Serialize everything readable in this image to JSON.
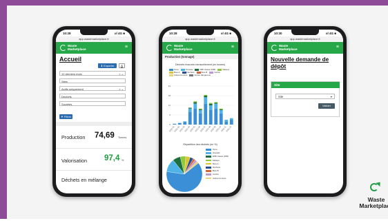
{
  "colors": {
    "frame": "#8e4c98",
    "brand_green": "#27a848",
    "primary_blue": "#2b6cb0",
    "kpi_green": "#1f9d3f",
    "button_dark": "#455a64"
  },
  "app": {
    "name_line1": "Waste",
    "name_line2": "Marketplace",
    "menu_icon": "hamburger-icon"
  },
  "status": {
    "time": "10:28",
    "time3": "10:30",
    "signal": "ııl 4G ■",
    "url": "app.wastemarketplace.fr"
  },
  "phone1": {
    "title": "Accueil",
    "export_label": "Exporter",
    "print_icon": "printer-icon",
    "filters": [
      {
        "value": "12 derniers mois",
        "dropdown": "× ⌄"
      },
      {
        "value": "Sites",
        "dropdown": ""
      },
      {
        "value": "Actifs uniquement",
        "dropdown": "× ⌄"
      },
      {
        "value": "Déchets",
        "dropdown": ""
      },
      {
        "value": "Sociétés",
        "dropdown": ""
      }
    ],
    "filter_button": "Filtrer",
    "kpis": [
      {
        "label": "Production",
        "value": "74,69",
        "unit": "Tonnes"
      },
      {
        "label": "Valorisation",
        "value": "97,4",
        "unit": "%"
      },
      {
        "label": "Déchets en mélange",
        "value": "",
        "unit": ""
      }
    ]
  },
  "phone2": {
    "section": "Production (tonnage)",
    "bar_title": "Déchets évacués mensuellement (en tonnes)",
    "pie_title": "Répartition des déchets (en %)",
    "legend": [
      {
        "name": "Terre",
        "color": "#3a8fd6"
      },
      {
        "name": "Gravats",
        "color": "#4fb3e8"
      },
      {
        "name": "DIB/ classé (DIB)",
        "color": "#1e6f3e"
      },
      {
        "name": "Métaux",
        "color": "#8fc93a"
      },
      {
        "name": "Bois A",
        "color": "#e0c42f"
      },
      {
        "name": "Déchets",
        "color": "#2a4d8f"
      },
      {
        "name": "Bois B",
        "color": "#d9633a"
      },
      {
        "name": "Carton",
        "color": "#b89ad6"
      },
      {
        "name": "Autres bennés",
        "color": "#e8d27a"
      },
      {
        "name": "Autres dangereux",
        "color": "#777777"
      }
    ],
    "pie_legend": [
      {
        "name": "Terre",
        "color": "#3a8fd6"
      },
      {
        "name": "Gravats",
        "color": "#4fb3e8"
      },
      {
        "name": "DIB/ classé (DIB)",
        "color": "#1e6f3e"
      },
      {
        "name": "Métaux",
        "color": "#8fc93a"
      },
      {
        "name": "Bois A",
        "color": "#e0c42f"
      },
      {
        "name": "Déchets",
        "color": "#2a4d8f"
      },
      {
        "name": "Bois B",
        "color": "#d9633a"
      },
      {
        "name": "Carton",
        "color": "#b89ad6"
      },
      {
        "name": "Autres bennés",
        "color": "#e8d27a"
      }
    ]
  },
  "chart_data": [
    {
      "type": "bar",
      "title": "Déchets évacués mensuellement (en tonnes)",
      "categories": [
        "2021-01",
        "2021-02",
        "2021-03",
        "2021-04",
        "2021-05",
        "2021-06",
        "2021-07",
        "2021-08",
        "2021-09",
        "2021-10",
        "2021-11",
        "2021-12"
      ],
      "series": [
        {
          "name": "Terre",
          "values": [
            0.5,
            1,
            1.5,
            8,
            10,
            7,
            13,
            9,
            10,
            7,
            2,
            3
          ]
        },
        {
          "name": "Gravats",
          "values": [
            0,
            0,
            0.5,
            2,
            3,
            2,
            4,
            3,
            3,
            2,
            1,
            1
          ]
        },
        {
          "name": "DIB/ classé (DIB)",
          "values": [
            0,
            0,
            0,
            0.5,
            1,
            0.5,
            1,
            1,
            0.5,
            0.5,
            0,
            0
          ]
        },
        {
          "name": "Métaux",
          "values": [
            0,
            0,
            0,
            0,
            0.5,
            0.5,
            0.5,
            0.5,
            0.5,
            0.5,
            0,
            0
          ]
        }
      ],
      "ylim": [
        0,
        24
      ],
      "grid": true,
      "legend": "top"
    },
    {
      "type": "pie",
      "title": "Répartition des déchets (en %)",
      "categories": [
        "Terre",
        "Gravats",
        "DIB/ classé (DIB)",
        "Métaux",
        "Bois A",
        "Déchets",
        "Bois B",
        "Carton",
        "Autres bennés"
      ],
      "values": [
        63,
        12,
        7,
        5,
        4,
        3,
        2,
        2,
        2
      ],
      "legend": "right"
    }
  ],
  "phone3": {
    "title": "Nouvelle demande de dépôt",
    "card_title": "Site",
    "select_value": "Site",
    "select_icon": "chevron-down-icon",
    "submit": "Valider"
  },
  "corner_logo": {
    "line1": "Waste",
    "line2": "Marketplace"
  }
}
